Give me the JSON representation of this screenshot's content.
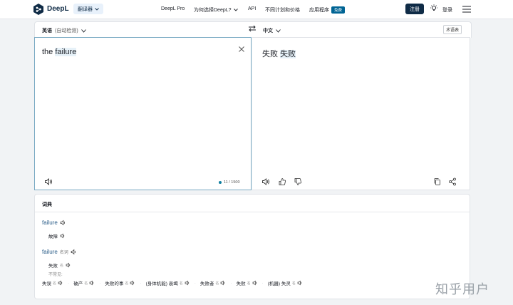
{
  "header": {
    "brand": "DeepL",
    "translator_label": "翻译器",
    "nav": [
      "DeepL Pro",
      "为何选择DeepL?",
      "API",
      "不同计划和价格",
      "应用程序"
    ],
    "nav_badge": "免费",
    "signup_label": "注册",
    "login_label": "登录"
  },
  "source": {
    "lang_label": "英语",
    "lang_note": "(自动检测)",
    "text_plain": "the ",
    "text_highlight": "failure",
    "char_count": "11 / 1500"
  },
  "target": {
    "lang_label": "中文",
    "glossary_label": "术语表",
    "text_first": "失败 ",
    "text_highlight": "失败"
  },
  "dictionary": {
    "title": "词典",
    "entries": [
      {
        "word": "failure",
        "pos": "",
        "senses": [
          {
            "text": "故障",
            "tag": ""
          }
        ]
      },
      {
        "word": "failure",
        "pos": "名词",
        "senses": [
          {
            "text": "失败",
            "tag": "名"
          }
        ]
      }
    ],
    "less_common_label": "不常见:",
    "alternatives": [
      {
        "text": "失误",
        "tag": "名"
      },
      {
        "text": "破产",
        "tag": "名"
      },
      {
        "text": "失败的事",
        "tag": "名"
      },
      {
        "text": "(身体机能) 衰竭",
        "tag": "名"
      },
      {
        "text": "失败者",
        "tag": "名"
      },
      {
        "text": "失败",
        "tag": "名"
      },
      {
        "text": "(机器) 失灵",
        "tag": "名"
      }
    ]
  },
  "watermark": "知乎用户",
  "colors": {
    "brand_navy": "#0f2b46",
    "accent_blue": "#006494",
    "source_border": "#79a9c3"
  }
}
